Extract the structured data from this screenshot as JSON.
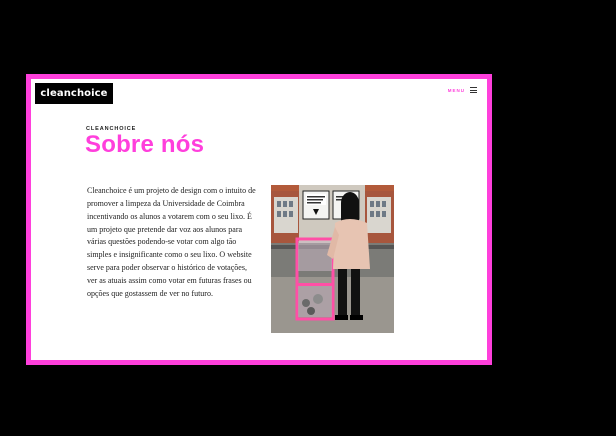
{
  "brand": {
    "logo_text": "cleanchoice"
  },
  "nav": {
    "menu_label": "MENU",
    "menu_icon": "hamburger-menu-icon"
  },
  "section": {
    "eyebrow": "CLEANCHOICE",
    "title": "Sobre nós",
    "paragraph": "Cleanchoice é um projeto de design com o intuito de promover a limpeza da Universidade de Coimbra incentivando os alunos a votarem com o seu lixo. É um projeto que pretende dar voz aos alunos para várias questões podendo-se votar com algo tão simples e insignificante como o seu lixo. O website serve para poder observar o histórico de votações, ver as atuais assim como votar em futuras frases ou opções que gostassem de ver no futuro."
  },
  "colors": {
    "accent": "#ff3fdc",
    "page_background": "#000000",
    "card_background": "#ffffff",
    "logo_background": "#000000"
  }
}
